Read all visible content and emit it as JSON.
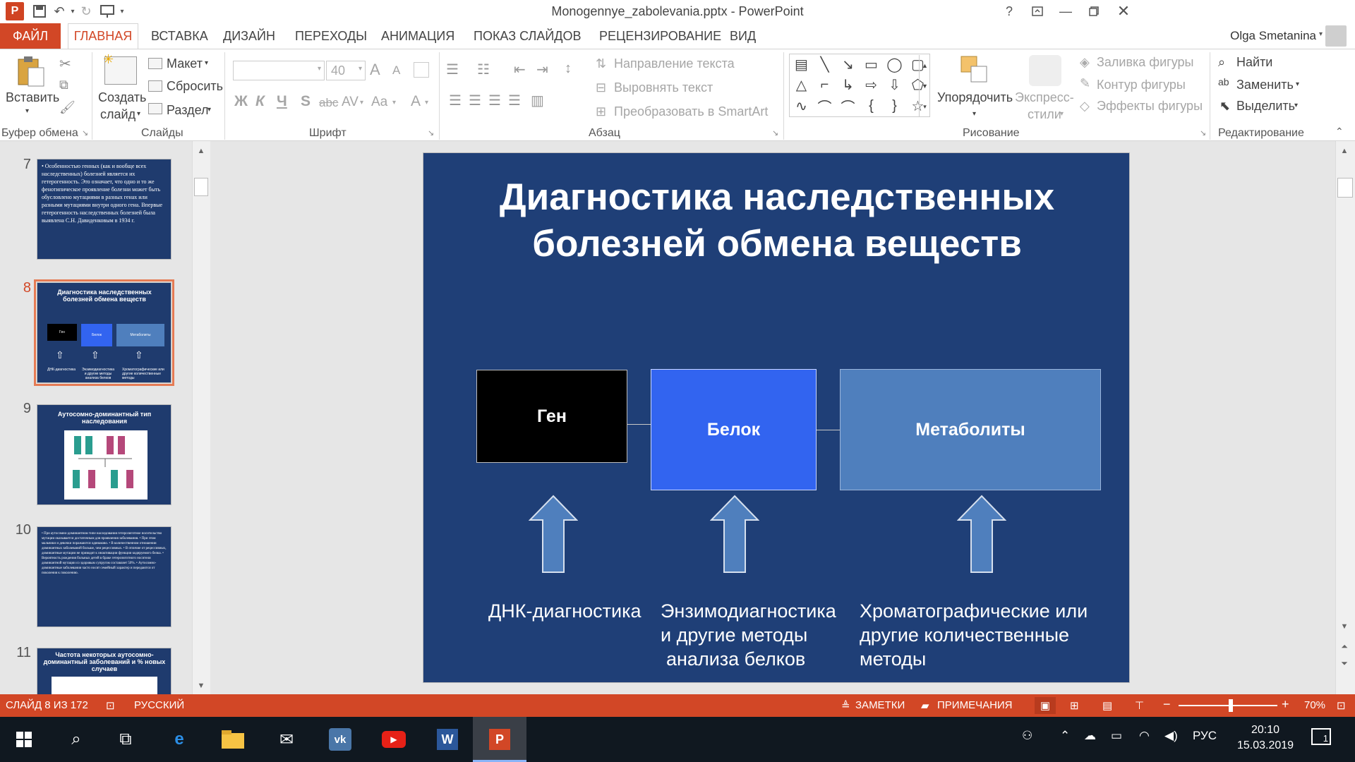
{
  "window": {
    "title": "Monogennye_zabolevania.pptx - PowerPoint",
    "help": "?",
    "user_name": "Olga Smetanina"
  },
  "tabs": {
    "file": "ФАЙЛ",
    "items": [
      "ГЛАВНАЯ",
      "ВСТАВКА",
      "ДИЗАЙН",
      "ПЕРЕХОДЫ",
      "АНИМАЦИЯ",
      "ПОКАЗ СЛАЙДОВ",
      "РЕЦЕНЗИРОВАНИЕ",
      "ВИД"
    ]
  },
  "ribbon": {
    "clipboard": {
      "paste": "Вставить",
      "group": "Буфер обмена"
    },
    "slides": {
      "new_slide_1": "Создать",
      "new_slide_2": "слайд",
      "layout": "Макет",
      "reset": "Сбросить",
      "section": "Раздел",
      "group": "Слайды"
    },
    "font": {
      "size": "40",
      "bold": "Ж",
      "italic": "К",
      "underline": "Ч",
      "shadow": "S",
      "strike": "abc",
      "spacing": "AV",
      "case": "Aa",
      "color": "A",
      "grow": "A",
      "shrink": "A",
      "group": "Шрифт"
    },
    "paragraph": {
      "direction": "Направление текста",
      "align": "Выровнять текст",
      "smartart": "Преобразовать в SmartArt",
      "group": "Абзац"
    },
    "drawing": {
      "arrange": "Упорядочить",
      "quick_styles_1": "Экспресс-",
      "quick_styles_2": "стили",
      "fill": "Заливка фигуры",
      "outline": "Контур фигуры",
      "effects": "Эффекты фигуры",
      "group": "Рисование"
    },
    "editing": {
      "find": "Найти",
      "replace": "Заменить",
      "select": "Выделить",
      "group": "Редактирование"
    }
  },
  "thumbnails": [
    {
      "num": "7",
      "text": "• Особенностью генных (как и вообще всех наследственных) болезней является их гетерогенность. Это означает, что одно и то же фенотипическое проявление болезни может быть обусловлено мутациями в разных генах или разными мутациями внутри одного гена. Впервые гетерогенность наследственных болезней была выявлена С.Н. Давиденковым в 1934 г."
    },
    {
      "num": "8",
      "title": "Диагностика наследственных болезней обмена веществ",
      "boxes": [
        "Ген",
        "Белок",
        "Метаболиты"
      ],
      "caps": [
        "ДНК-диагностика",
        "Энзимодиагностика и другие методы анализа белков",
        "Хроматографические или другие количественные методы"
      ]
    },
    {
      "num": "9",
      "title": "Аутосомно-доминантный тип наследования"
    },
    {
      "num": "10",
      "text": "• При аутосомно-доминантном типе наследования гетерозиготное носительство мутации оказывается достаточным для проявления заболевания. • При этом мальчики и девочки поражаются одинаково. • В количественном отношении доминантных заболеваний больше, чем рецессивных. • В отличие от рецессивных, доминантные мутации не приводят к инактивации функции кодируемого белка. • Вероятность рождения больных детей в браке гетерозиготного носителя доминантной мутации со здоровым супругом составляет 50%. • Аутосомно-доминантные заболевания часто носят семейный характер и передаются от поколения к поколению."
    },
    {
      "num": "11",
      "title": "Частота некоторых аутосомно-доминантный заболеваний и % новых случаев"
    }
  ],
  "slide": {
    "title_line1": "Диагностика наследственных",
    "title_line2": "болезней обмена веществ",
    "box_gene": "Ген",
    "box_protein": "Белок",
    "box_metabolites": "Метаболиты",
    "cap1": "ДНК-диагностика",
    "cap2_l1": "Энзимодиагностика",
    "cap2_l2": "и другие методы",
    "cap2_l3": "анализа белков",
    "cap3_l1": "Хроматографические  или",
    "cap3_l2": "другие количественные",
    "cap3_l3": "методы",
    "colors": {
      "background": "#1f3f77",
      "gene": "#000000",
      "protein": "#3264f0",
      "metabolites": "#4f7fbd",
      "arrow": "#4f7fbd"
    }
  },
  "status": {
    "slide_info": "СЛАЙД 8 ИЗ 172",
    "language": "РУССКИЙ",
    "notes": "ЗАМЕТКИ",
    "comments": "ПРИМЕЧАНИЯ",
    "zoom": "70%",
    "zoom_level": 0.53
  },
  "taskbar": {
    "lang": "РУС",
    "time": "20:10",
    "date": "15.03.2019",
    "notifications": "1",
    "apps": [
      "start-icon",
      "search-icon",
      "task-view-icon",
      "edge-icon",
      "explorer-icon",
      "mail-icon",
      "vk-icon",
      "youtube-icon",
      "word-icon",
      "powerpoint-icon"
    ]
  }
}
